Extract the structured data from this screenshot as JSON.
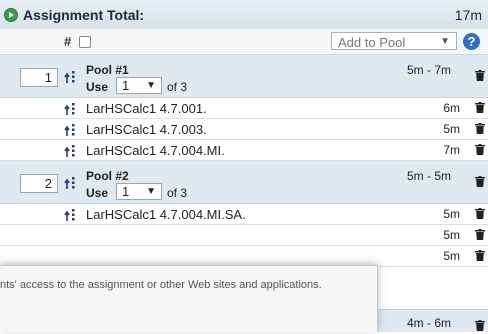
{
  "header": {
    "title": "Assignment Total:",
    "total": "17m",
    "play_icon": "play-circle-icon"
  },
  "toolbar": {
    "number_label": "#",
    "add_to_pool_placeholder": "Add to Pool",
    "help_label": "?"
  },
  "pools": [
    {
      "number": "1",
      "title": "Pool #1",
      "use_label": "Use",
      "use_value": "1",
      "of_label": "of 3",
      "range": "5m - 7m",
      "items": [
        {
          "name": "LarHSCalc1 4.7.001.",
          "time": "6m"
        },
        {
          "name": "LarHSCalc1 4.7.003.",
          "time": "5m"
        },
        {
          "name": "LarHSCalc1 4.7.004.MI.",
          "time": "7m"
        }
      ]
    },
    {
      "number": "2",
      "title": "Pool #2",
      "use_label": "Use",
      "use_value": "1",
      "of_label": "of 3",
      "range": "5m - 5m",
      "items": [
        {
          "name": "LarHSCalc1 4.7.004.MI.SA.",
          "time": "5m"
        },
        {
          "name": "",
          "time": "5m"
        },
        {
          "name": "",
          "time": "5m"
        }
      ]
    },
    {
      "range": "4m - 6m"
    }
  ],
  "dialog": {
    "message": "nts' access to the assignment or other Web sites and applications."
  },
  "colors": {
    "header_bg": "#d5e1ec",
    "pool_bg": "#dfe9f2",
    "play": "#3a9c48",
    "help": "#2a72c8",
    "drag": "#1f3f7a"
  }
}
